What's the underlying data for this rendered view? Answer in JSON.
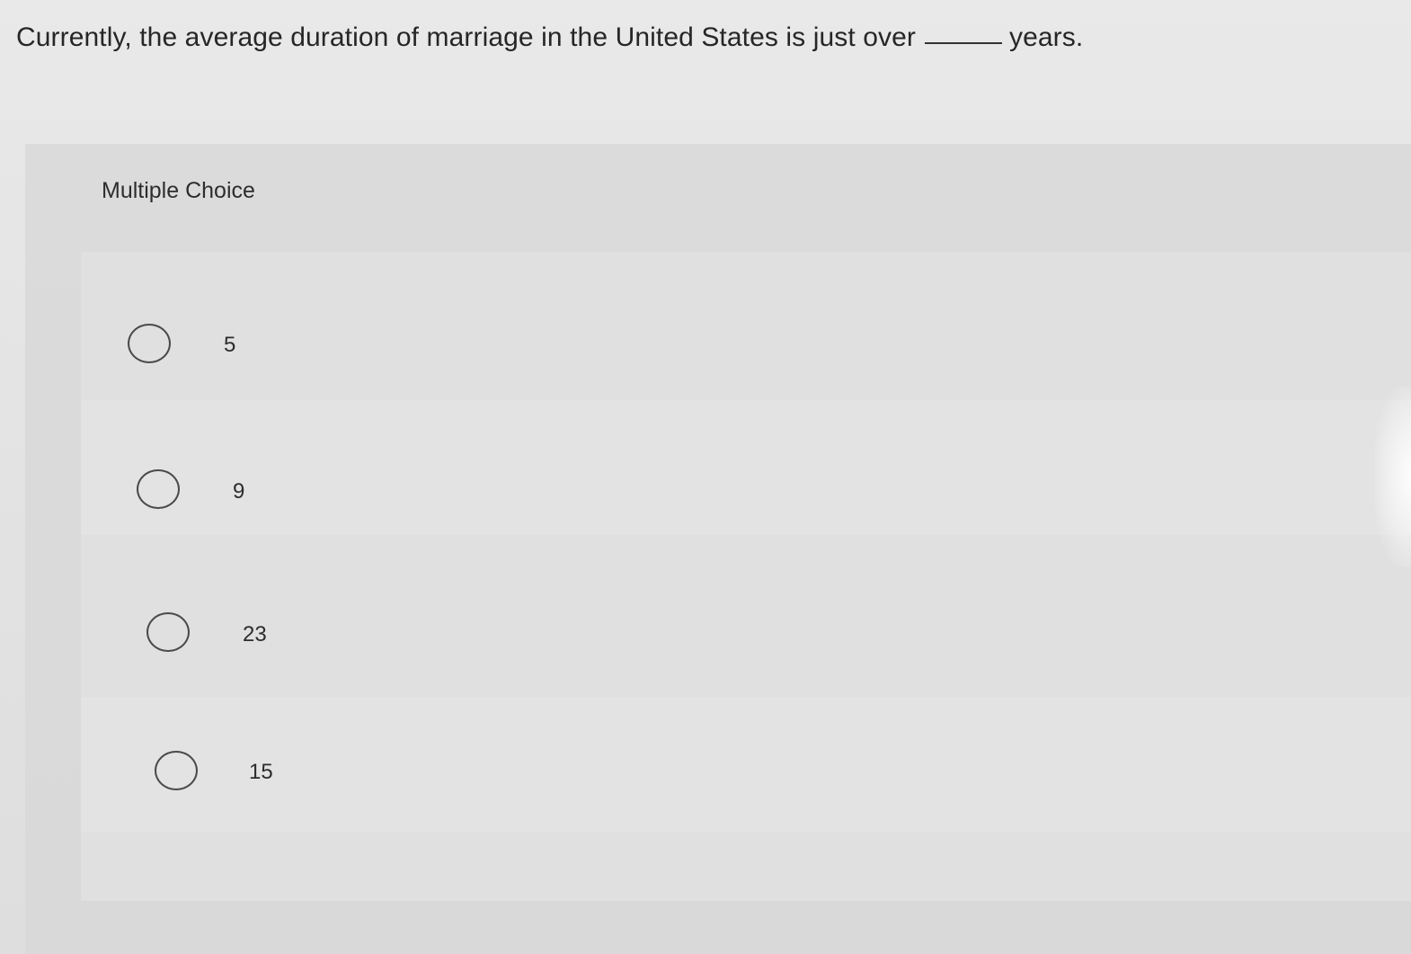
{
  "question": {
    "text_before": "Currently, the average duration of marriage in the United States is just over",
    "text_after": "years."
  },
  "multiple_choice": {
    "heading": "Multiple Choice",
    "options": [
      {
        "label": "5"
      },
      {
        "label": "9"
      },
      {
        "label": "23"
      },
      {
        "label": "15"
      }
    ]
  }
}
